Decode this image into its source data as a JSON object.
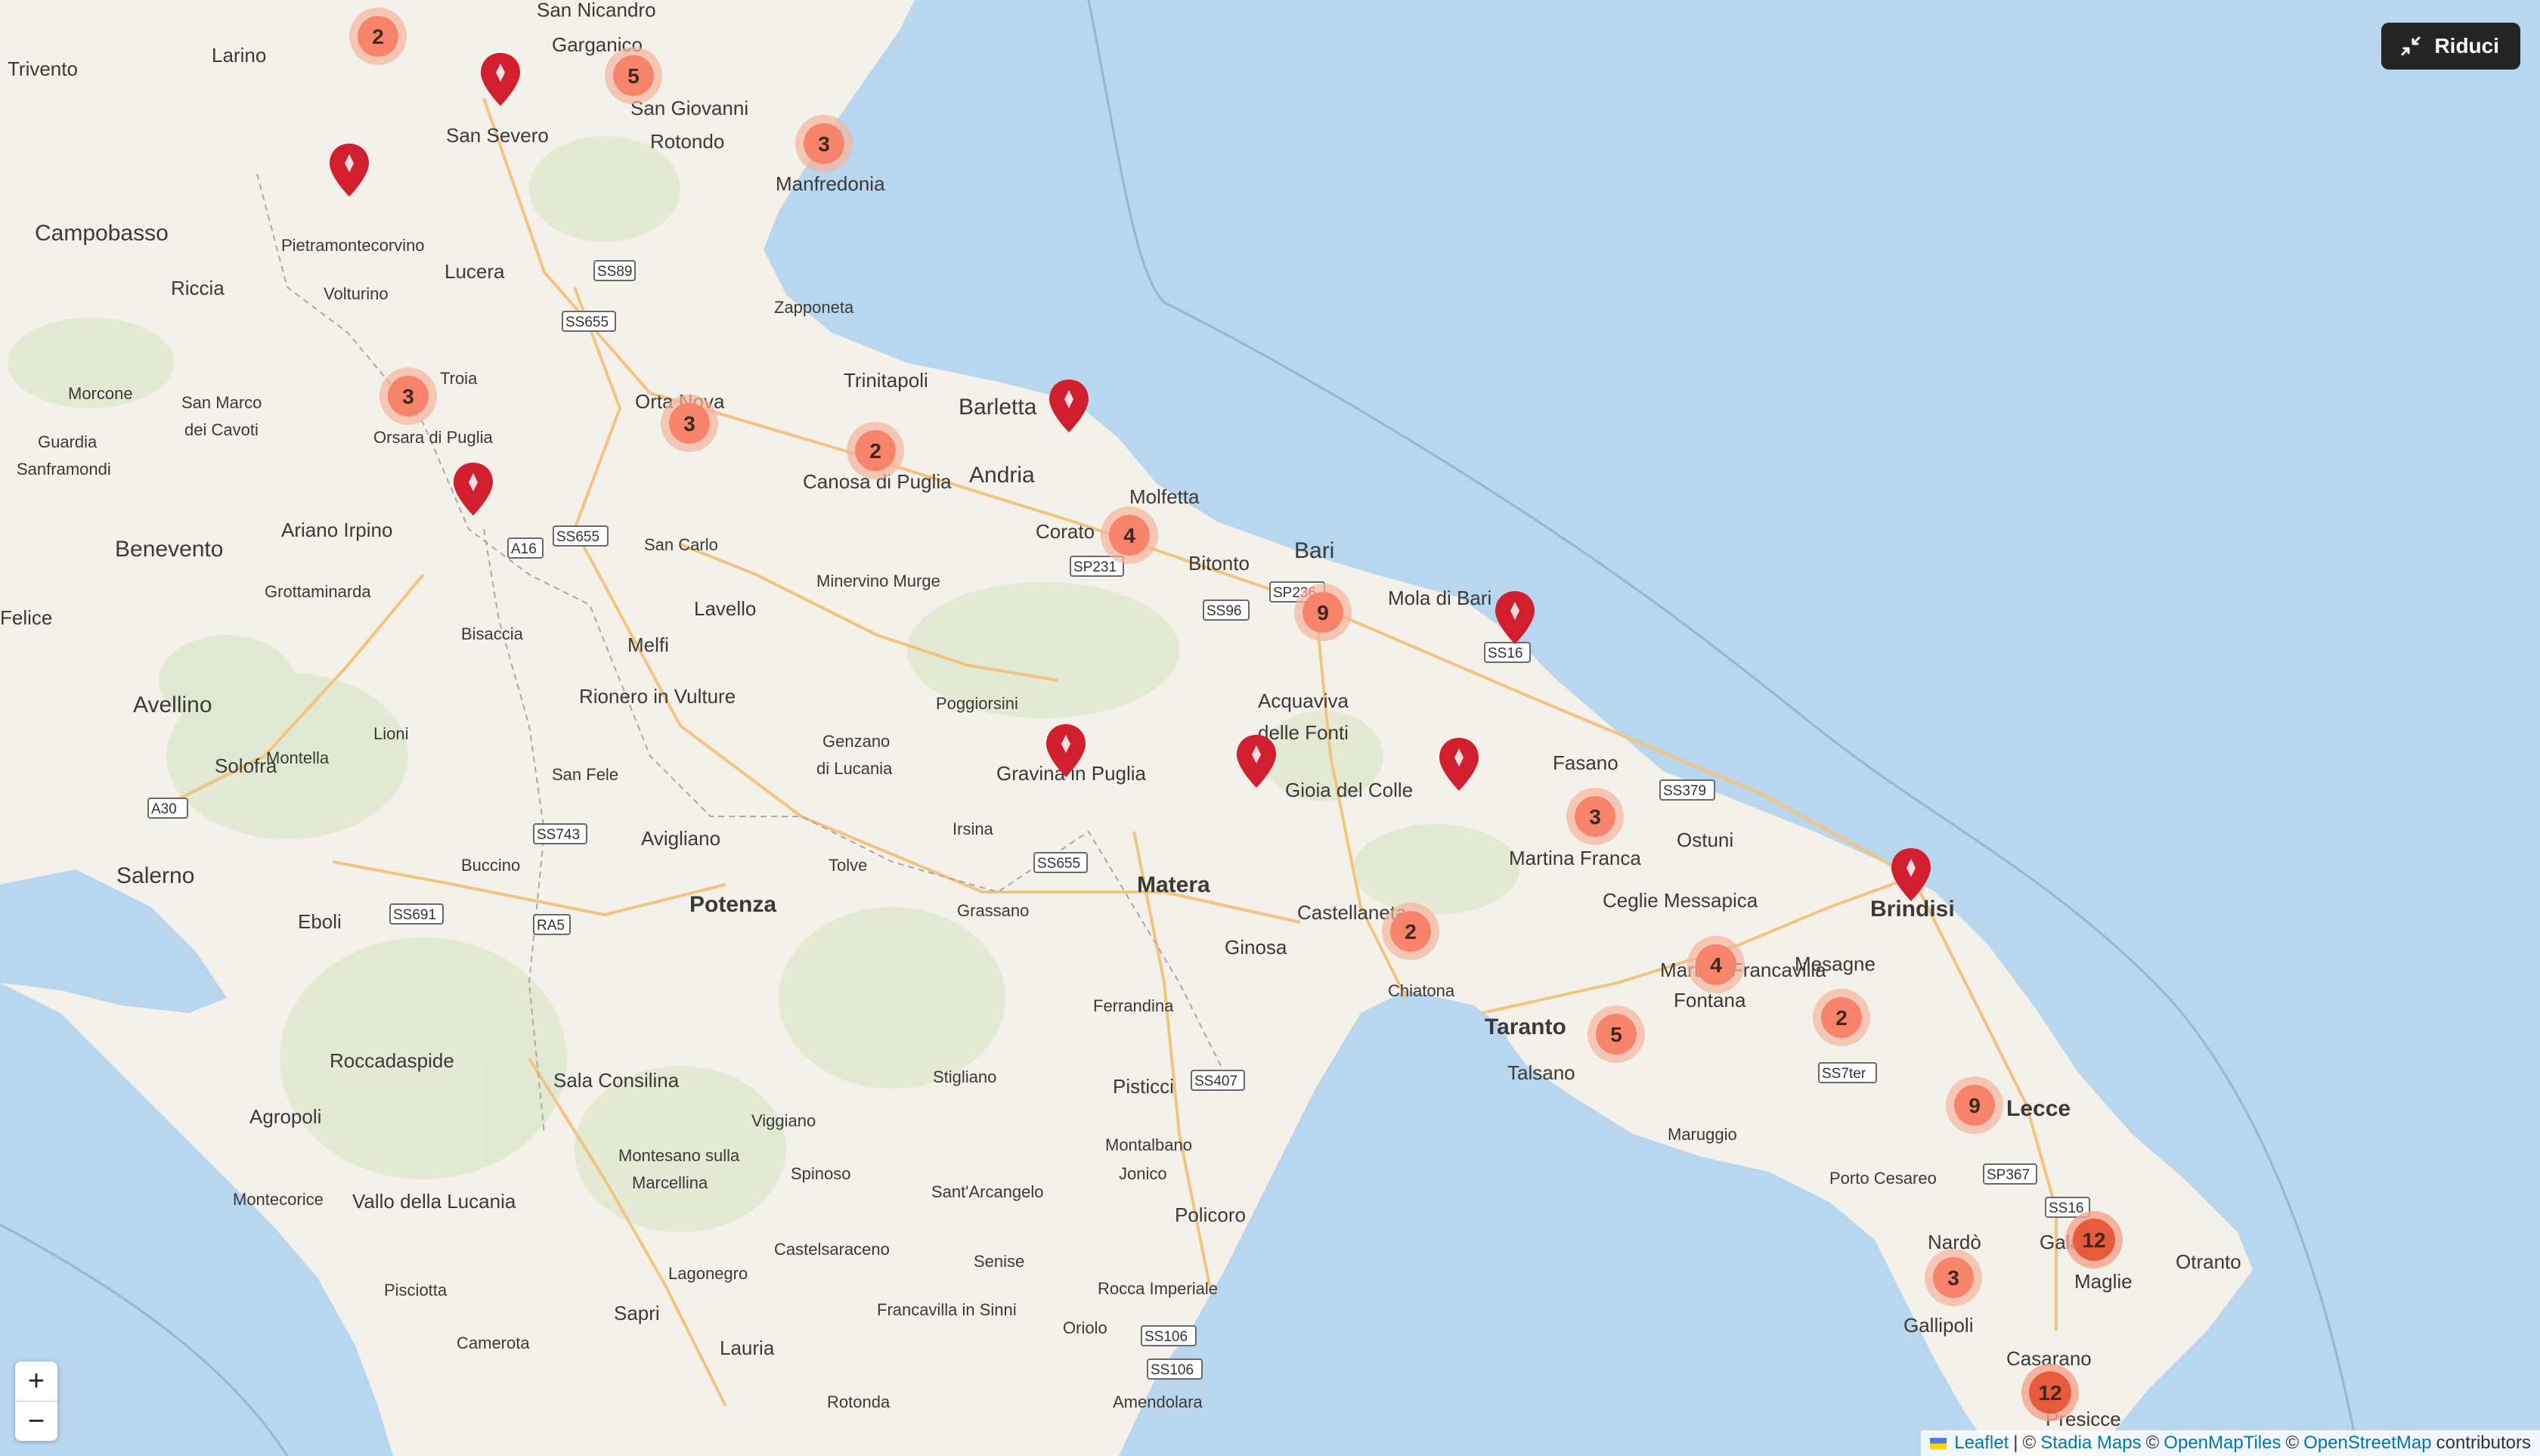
{
  "toggle_label": "Riduci",
  "zoom": {
    "in_label": "+",
    "out_label": "−"
  },
  "attribution": {
    "leaflet": "Leaflet",
    "sep1": "|",
    "copy": "©",
    "stadia": "Stadia Maps",
    "openmaptiles": "OpenMapTiles",
    "osm": "OpenStreetMap",
    "tail": "contributors"
  },
  "colors": {
    "sea": "#b9d6ef",
    "land": "#f4f1ea",
    "cluster_small": "#f88e6e",
    "cluster_large": "#e85a3c",
    "marker": "#d11f2f"
  },
  "places": [
    "Larino",
    "San Nicandro",
    "Garganico",
    "Trivento",
    "San Severo",
    "San Giovanni",
    "Rotondo",
    "Manfredonia",
    "Campobasso",
    "Pietramontecorvino",
    "Lucera",
    "Riccia",
    "Volturino",
    "Zapponeta",
    "Troia",
    "Morcone",
    "San Marco",
    "dei Cavoti",
    "Orsara di Puglia",
    "Orta Nova",
    "Trinitapoli",
    "Barletta",
    "Guardia",
    "Sanframondi",
    "Canosa di Puglia",
    "Andria",
    "Ariano Irpino",
    "Molfetta",
    "Corato",
    "Benevento",
    "San Carlo",
    "Bari",
    "Bitonto",
    "Minervino Murge",
    "Grottaminarda",
    "Lavello",
    "Mola di Bari",
    "Bisaccia",
    "Melfi",
    "Felice",
    "Avellino",
    "Rionero in Vulture",
    "Acquaviva",
    "delle Fonti",
    "Poggiorsini",
    "Genzano",
    "di Lucania",
    "Lioni",
    "Gravina in Puglia",
    "Gioia del Colle",
    "Fasano",
    "Solofra",
    "Montella",
    "San Fele",
    "Ostuni",
    "Martina Francavilla",
    "Avigliano",
    "Irsina",
    "Tolve",
    "Matera",
    "Martina Franca",
    "Ceglie Messapica",
    "Brindisi",
    "Salerno",
    "Eboli",
    "Buccino",
    "Potenza",
    "Grassano",
    "Castellaneta",
    "Ginosa",
    "Mesagne",
    "Fontana",
    "Chiatona",
    "Taranto",
    "Ferrandina",
    "Roccadaspide",
    "Sala Consilina",
    "Talsano",
    "Stigliano",
    "Pisticci",
    "Lecce",
    "Agropoli",
    "Viggiano",
    "Maruggio",
    "Montalbano",
    "Jonico",
    "Montecorice",
    "Vallo della Lucania",
    "Montesano sulla",
    "Marcellina",
    "Spinoso",
    "Sant'Arcangelo",
    "Policoro",
    "Porto Cesareo",
    "Castelsaraceno",
    "Nardò",
    "Galatina",
    "Otranto",
    "Pisciotta",
    "Lagonegro",
    "Senise",
    "Rocca Imperiale",
    "Maglie",
    "Sapri",
    "Francavilla in Sinni",
    "Camerota",
    "Lauria",
    "Oriolo",
    "Gallipoli",
    "Casarano",
    "Rotonda",
    "Amendolara",
    "Presicce"
  ],
  "roads": [
    "SS89",
    "SS655",
    "A16",
    "SS655",
    "SP231",
    "SS96",
    "SP236",
    "SS16",
    "SS379",
    "SS743",
    "A30",
    "SS691",
    "RA5",
    "SS655",
    "SS7ter",
    "SS407",
    "SP367",
    "SS16",
    "SS106",
    "SS106"
  ],
  "clusters": [
    "2",
    "5",
    "3",
    "3",
    "3",
    "2",
    "4",
    "9",
    "3",
    "2",
    "4",
    "2",
    "5",
    "9",
    "12",
    "3",
    "12"
  ],
  "markers_count": 10
}
